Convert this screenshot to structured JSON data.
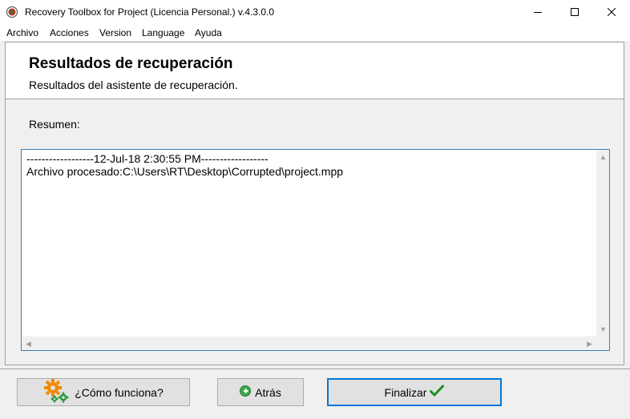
{
  "window": {
    "title": "Recovery Toolbox for Project (Licencia Personal.) v.4.3.0.0"
  },
  "menu": [
    "Archivo",
    "Acciones",
    "Version",
    "Language",
    "Ayuda"
  ],
  "header": {
    "title": "Resultados de recuperación",
    "subtitle": "Resultados del asistente de recuperación."
  },
  "summary": {
    "label": "Resumen:",
    "log_lines": [
      "------------------12-Jul-18 2:30:55 PM------------------",
      "Archivo procesado:C:\\Users\\RT\\Desktop\\Corrupted\\project.mpp"
    ]
  },
  "buttons": {
    "help": "¿Cómo funciona?",
    "back": "Atrás",
    "finish": "Finalizar"
  },
  "icons": {
    "app": "app-logo-icon",
    "help": "gears-icon",
    "back": "back-arrow-icon",
    "finish": "checkmark-icon"
  },
  "colors": {
    "accent": "#0078d7",
    "logbox_border": "#3c7fb1",
    "gear_orange": "#f08a00",
    "gear_green": "#2e9a3a",
    "check_green": "#1e8e1e"
  }
}
